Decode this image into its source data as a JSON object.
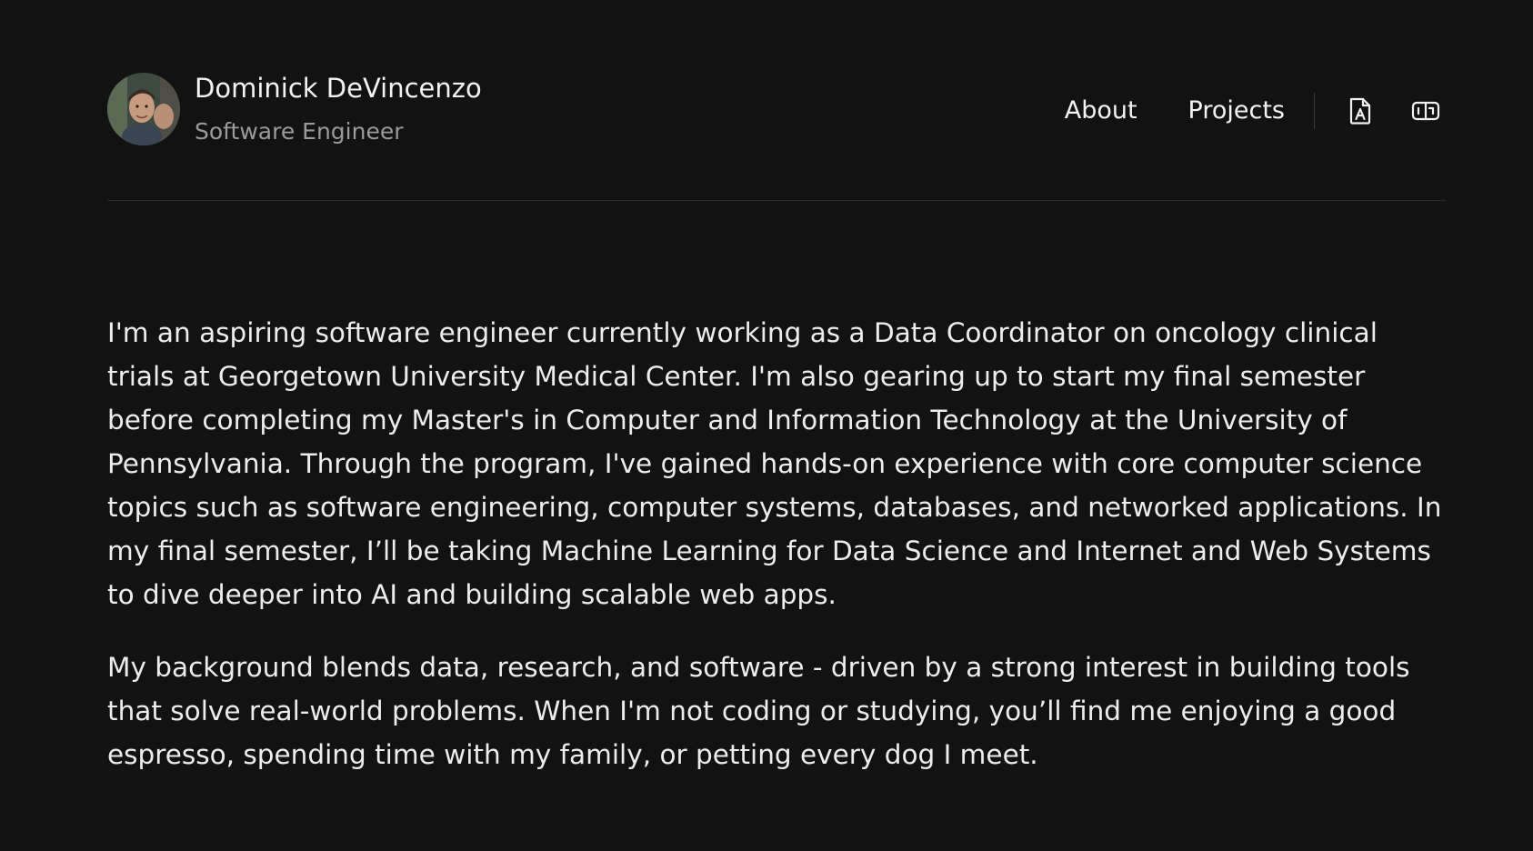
{
  "header": {
    "name": "Dominick DeVincenzo",
    "role": "Software Engineer"
  },
  "nav": {
    "about_label": "About",
    "projects_label": "Projects",
    "icons": [
      "resume-file-icon",
      "id-card-icon"
    ]
  },
  "main": {
    "paragraphs": [
      "I'm an aspiring software engineer currently working as a Data Coordinator on oncology clinical trials at Georgetown University Medical Center. I'm also gearing up to start my final semester before completing my Master's in Computer and Information Technology at the University of Pennsylvania. Through the program, I've gained hands-on experience with core computer science topics such as software engineering, computer systems, databases, and networked applications. In my final semester, I’ll be taking Machine Learning for Data Science and Internet and Web Systems to dive deeper into AI and building scalable web apps.",
      "My background blends data, research, and software - driven by a strong interest in building tools that solve real-world problems. When I'm not coding or studying, you’ll find me enjoying a good espresso, spending time with my family, or petting every dog I meet."
    ]
  },
  "colors": {
    "background": "#121212",
    "text": "#ededed",
    "muted": "#9a9a9a",
    "divider": "#2c2c2c"
  }
}
